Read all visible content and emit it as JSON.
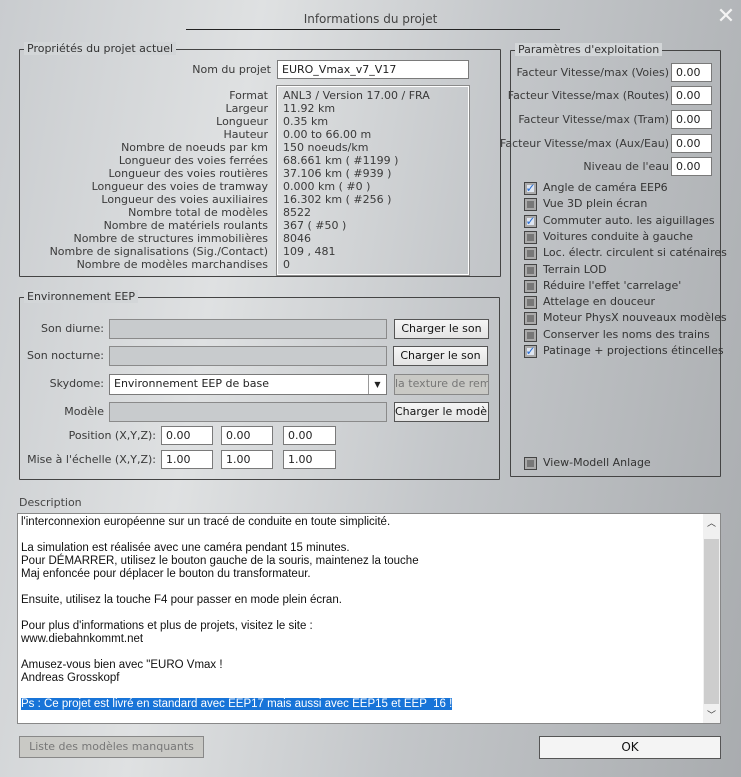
{
  "window": {
    "title": "Informations du projet",
    "close_icon": "close-icon"
  },
  "project": {
    "legend": "Propriétés du projet actuel",
    "name_label": "Nom du projet",
    "name_value": "EURO_Vmax_v7_V17",
    "props": [
      {
        "label": "Format",
        "value": "ANL3 / Version 17.00 / FRA"
      },
      {
        "label": "Largeur",
        "value": "11.92 km"
      },
      {
        "label": "Longueur",
        "value": "0.35 km"
      },
      {
        "label": "Hauteur",
        "value": "0.00 to 66.00 m"
      },
      {
        "label": "Nombre de noeuds par km",
        "value": "150  noeuds/km"
      },
      {
        "label": "Longueur des voies ferrées",
        "value": "68.661 km ( #1199 )"
      },
      {
        "label": "Longueur des voies routières",
        "value": "37.106 km ( #939 )"
      },
      {
        "label": "Longueur des voies de tramway",
        "value": "0.000 km ( #0 )"
      },
      {
        "label": "Longueur des voies auxiliaires",
        "value": "16.302 km ( #256 )"
      },
      {
        "label": "Nombre total de modèles",
        "value": "8522"
      },
      {
        "label": "Nombre de matériels roulants",
        "value": "367 ( #50 )"
      },
      {
        "label": "Nombre de structures immobilières",
        "value": "8046"
      },
      {
        "label": "Nombre de signalisations (Sig./Contact)",
        "value": "109 , 481"
      },
      {
        "label": "Nombre de modèles marchandises",
        "value": "0"
      }
    ]
  },
  "environment": {
    "legend": "Environnement EEP",
    "day_sound_label": "Son diurne:",
    "day_sound_value": "",
    "day_sound_button": "Charger le son",
    "night_sound_label": "Son nocturne:",
    "night_sound_value": "",
    "night_sound_button": "Charger le son",
    "skydome_label": "Skydome:",
    "skydome_value": "Environnement EEP de base",
    "texture_button": "la texture de rempla",
    "model_label": "Modèle",
    "model_value": "",
    "model_button": "Charger le modèle",
    "position_label": "Position (X,Y,Z):",
    "position": [
      "0.00",
      "0.00",
      "0.00"
    ],
    "scale_label": "Mise à l'échelle (X,Y,Z):",
    "scale": [
      "1.00",
      "1.00",
      "1.00"
    ]
  },
  "operation": {
    "legend": "Paramètres d'exploitation",
    "factors": [
      {
        "label": "Facteur Vitesse/max (Voies)",
        "value": "0.00"
      },
      {
        "label": "Facteur Vitesse/max (Routes)",
        "value": "0.00"
      },
      {
        "label": "Facteur Vitesse/max (Tram)",
        "value": "0.00"
      },
      {
        "label": "Facteur Vitesse/max (Aux/Eau)",
        "value": "0.00"
      },
      {
        "label": "Niveau de l'eau",
        "value": "0.00"
      }
    ],
    "checkboxes": [
      {
        "label": "Angle de caméra EEP6",
        "checked": true
      },
      {
        "label": "Vue 3D plein écran",
        "checked": false
      },
      {
        "label": "Commuter auto. les aiguillages",
        "checked": true
      },
      {
        "label": "Voitures conduite à gauche",
        "checked": false
      },
      {
        "label": "Loc. électr. circulent si caténaires",
        "checked": false
      },
      {
        "label": "Terrain LOD",
        "checked": false
      },
      {
        "label": "Réduire l'effet 'carrelage'",
        "checked": false
      },
      {
        "label": "Attelage en douceur",
        "checked": false
      },
      {
        "label": "Moteur PhysX nouveaux modèles",
        "checked": false
      },
      {
        "label": "Conserver les noms des trains",
        "checked": false
      },
      {
        "label": "Patinage + projections étincelles",
        "checked": true
      }
    ],
    "view_model": {
      "label": "View-Modell Anlage",
      "checked": false
    }
  },
  "description": {
    "label": "Description",
    "text": "l'interconnexion européenne sur un tracé de conduite en toute simplicité.\n\nLa simulation est réalisée avec une caméra pendant 15 minutes.\nPour DÉMARRER, utilisez le bouton gauche de la souris, maintenez la touche\nMaj enfoncée pour déplacer le bouton du transformateur.\n\nEnsuite, utilisez la touche F4 pour passer en mode plein écran.\n\nPour plus d'informations et plus de projets, visitez le site :\nwww.diebahnkommt.net\n\nAmusez-vous bien avec \"EURO Vmax !\nAndreas Grosskopf\n\n",
    "selected_text": "Ps : Ce projet est livré en standard avec EEP17 mais aussi avec EEP15 et EEP  16 !"
  },
  "footer": {
    "missing_models_button": "Liste des modèles manquants",
    "ok_button": "OK"
  },
  "colors": {
    "selection": "#1874d8",
    "checkmark": "#2a6fd4"
  }
}
